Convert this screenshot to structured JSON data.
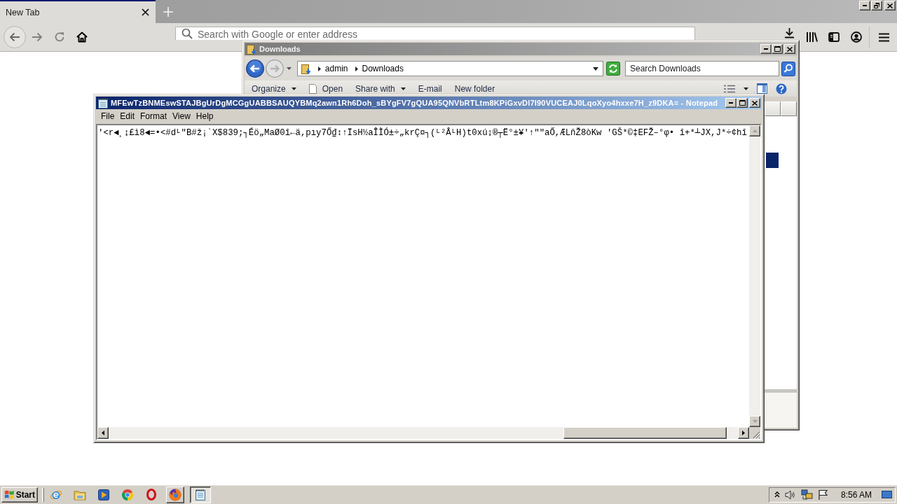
{
  "browser": {
    "tabs": [
      {
        "label": "New Tab",
        "selected": true
      }
    ],
    "address_bar": {
      "placeholder": "Search with Google or enter address"
    }
  },
  "explorer": {
    "title": "Downloads",
    "active": false,
    "breadcrumb": [
      "admin",
      "Downloads"
    ],
    "search": {
      "placeholder": "Search Downloads"
    },
    "toolbar": [
      {
        "label": "Organize",
        "kind": "dropdown"
      },
      {
        "label": "Open",
        "kind": "icon"
      },
      {
        "label": "Share with",
        "kind": "dropdown"
      },
      {
        "label": "E-mail",
        "kind": "plain"
      },
      {
        "label": "New folder",
        "kind": "plain"
      }
    ]
  },
  "notepad": {
    "title": "MFEwTzBNMEswSTAJBgUrDgMCGgUABBSAUQYBMq2awn1Rh6Doh_sBYgFV7gQUA95QNVbRTLtm8KPiGxvDl7I90VUCEAJ0LqoXyo4hxxe7H_z9DKA= - Notepad",
    "active": true,
    "menu": [
      "File",
      "Edit",
      "Format",
      "View",
      "Help"
    ],
    "text": "'<r◄¸↨£ì8◄=•<#dᴸ\"B#ž¡`X$839;┐Éö„MaØ0î←ä,pıy7Ő₫↕↑ÏsH½aÎÌÓ±÷„krÇ¤┐(ᴸ²ÂᴸH)t0xú↨®┬Ë°±¥'↑\"\"aŐ,ÆLňŽ8òKw 'GŠ*©‡EFŽ–°φ• î+*┴JX,J*÷¢hî"
  },
  "taskbar": {
    "start": "Start",
    "apps": [
      {
        "kind": "ie",
        "running": false,
        "selected": false
      },
      {
        "kind": "folder",
        "running": false,
        "selected": false
      },
      {
        "kind": "media",
        "running": false,
        "selected": false
      },
      {
        "kind": "chrome",
        "running": false,
        "selected": false
      },
      {
        "kind": "opera",
        "running": false,
        "selected": false
      },
      {
        "kind": "firefox",
        "running": true,
        "selected": false
      },
      {
        "kind": "notepad",
        "running": true,
        "selected": true
      }
    ],
    "clock": "8:56 AM"
  }
}
